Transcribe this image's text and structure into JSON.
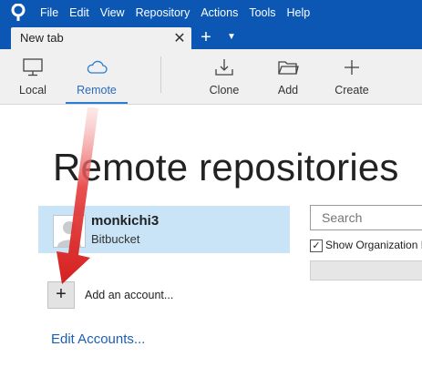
{
  "app": {
    "logo_icon": "sourcetree-logo",
    "accent_color": "#0b57b3"
  },
  "menu": {
    "items": [
      "File",
      "Edit",
      "View",
      "Repository",
      "Actions",
      "Tools",
      "Help"
    ]
  },
  "tabs": {
    "active_label": "New tab",
    "close_glyph": "✕",
    "new_tab_glyph": "+",
    "dropdown_glyph": "▼"
  },
  "toolbar": {
    "local_label": "Local",
    "remote_label": "Remote",
    "clone_label": "Clone",
    "add_label": "Add",
    "create_label": "Create"
  },
  "main": {
    "heading": "Remote repositories",
    "account": {
      "name": "monkichi3",
      "host": "Bitbucket"
    },
    "search_placeholder": "Search",
    "show_org_label": "Show Organization R",
    "add_glyph": "+",
    "add_account_label": "Add an account...",
    "edit_accounts_label": "Edit Accounts..."
  }
}
